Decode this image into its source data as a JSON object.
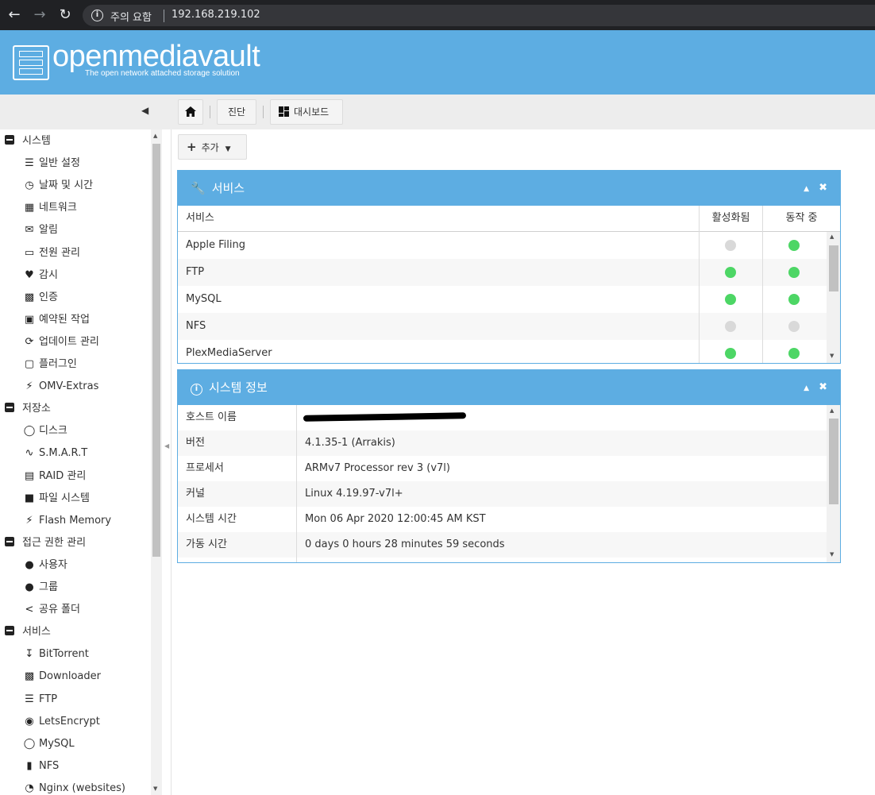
{
  "browser": {
    "security_warning": "주의 요함",
    "url": "192.168.219.102"
  },
  "header": {
    "logo_text": "openmediavault",
    "logo_subtitle": "The open network attached storage solution"
  },
  "toolbar": {
    "home_icon": "home-icon",
    "diagnostics": "진단",
    "dashboard": "대시보드"
  },
  "sidebar": {
    "categories": [
      {
        "label": "시스템",
        "items": [
          {
            "label": "일반 설정",
            "icon": "sliders-icon"
          },
          {
            "label": "날짜 및 시간",
            "icon": "clock-icon"
          },
          {
            "label": "네트워크",
            "icon": "network-icon"
          },
          {
            "label": "알림",
            "icon": "mail-icon"
          },
          {
            "label": "전원 관리",
            "icon": "battery-icon"
          },
          {
            "label": "감시",
            "icon": "heartbeat-icon"
          },
          {
            "label": "인증",
            "icon": "certificate-icon"
          },
          {
            "label": "예약된 작업",
            "icon": "calendar-clock-icon"
          },
          {
            "label": "업데이트 관리",
            "icon": "refresh-icon"
          },
          {
            "label": "플러그인",
            "icon": "puzzle-icon"
          },
          {
            "label": "OMV-Extras",
            "icon": "plug-icon"
          }
        ]
      },
      {
        "label": "저장소",
        "items": [
          {
            "label": "디스크",
            "icon": "harddisk-icon"
          },
          {
            "label": "S.M.A.R.T",
            "icon": "pulse-icon"
          },
          {
            "label": "RAID 관리",
            "icon": "database-icon"
          },
          {
            "label": "파일 시스템",
            "icon": "folder-icon"
          },
          {
            "label": "Flash Memory",
            "icon": "flash-icon"
          }
        ]
      },
      {
        "label": "접근 권한 관리",
        "items": [
          {
            "label": "사용자",
            "icon": "user-icon"
          },
          {
            "label": "그룹",
            "icon": "group-icon"
          },
          {
            "label": "공유 폴더",
            "icon": "share-icon"
          }
        ]
      },
      {
        "label": "서비스",
        "items": [
          {
            "label": "BitTorrent",
            "icon": "download-tray-icon"
          },
          {
            "label": "Downloader",
            "icon": "download-box-icon"
          },
          {
            "label": "FTP",
            "icon": "server-icon"
          },
          {
            "label": "LetsEncrypt",
            "icon": "lock-icon"
          },
          {
            "label": "MySQL",
            "icon": "database-outline-icon"
          },
          {
            "label": "NFS",
            "icon": "desktop-icon"
          },
          {
            "label": "Nginx (websites)",
            "icon": "globe-icon"
          }
        ]
      }
    ]
  },
  "content": {
    "add_button": "추가",
    "services_panel": {
      "title": "서비스",
      "columns": [
        "서비스",
        "활성화됨",
        "동작 중"
      ],
      "rows": [
        {
          "name": "Apple Filing",
          "enabled": false,
          "running": true
        },
        {
          "name": "FTP",
          "enabled": true,
          "running": true
        },
        {
          "name": "MySQL",
          "enabled": true,
          "running": true
        },
        {
          "name": "NFS",
          "enabled": false,
          "running": false
        },
        {
          "name": "PlexMediaServer",
          "enabled": true,
          "running": true
        }
      ]
    },
    "sysinfo_panel": {
      "title": "시스템 정보",
      "rows": [
        {
          "label": "호스트 이름",
          "value": ""
        },
        {
          "label": "버전",
          "value": "4.1.35-1 (Arrakis)"
        },
        {
          "label": "프로세서",
          "value": "ARMv7 Processor rev 3 (v7l)"
        },
        {
          "label": "커널",
          "value": "Linux 4.19.97-v7l+"
        },
        {
          "label": "시스템 시간",
          "value": "Mon 06 Apr 2020 12:00:45 AM KST"
        },
        {
          "label": "가동 시간",
          "value": "0 days 0 hours 28 minutes 59 seconds"
        }
      ]
    }
  },
  "colors": {
    "brand": "#5dade2",
    "status_on": "#4dd665",
    "status_off": "#d9d9d9"
  }
}
